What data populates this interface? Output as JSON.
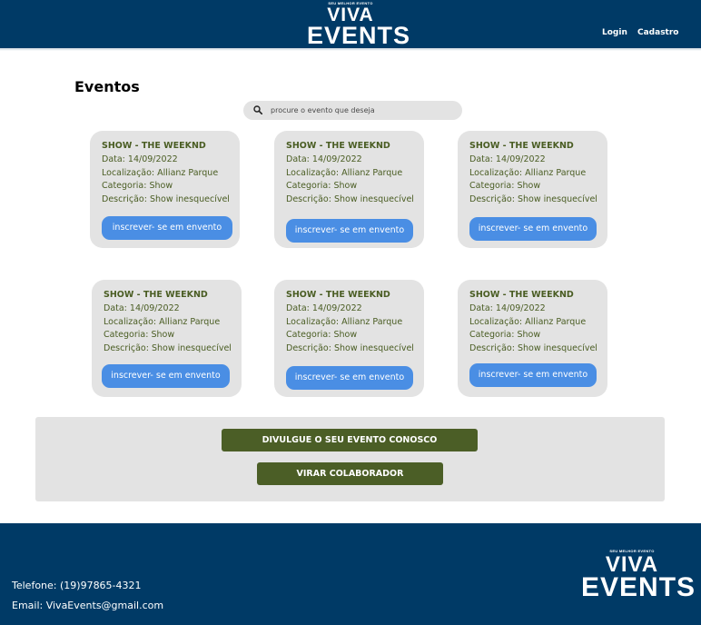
{
  "header": {
    "logo_tag": "SEU MELHOR EVENTO",
    "logo_line1": "VIVA",
    "logo_line2": "EVENTS",
    "nav": {
      "login": "Login",
      "cadastro": "Cadastro"
    }
  },
  "main": {
    "title": "Eventos",
    "search": {
      "placeholder": "procure o evento que deseja"
    },
    "cards": [
      {
        "title": "SHOW - THE WEEKND",
        "date": "Data: 14/09/2022",
        "location": "Localização: Allianz Parque",
        "category": "Categoria: Show",
        "description": "Descrição: Show inesquecível",
        "button": "inscrever- se em envento"
      },
      {
        "title": "SHOW - THE WEEKND",
        "date": "Data: 14/09/2022",
        "location": "Localização: Allianz Parque",
        "category": "Categoria: Show",
        "description": "Descrição: Show inesquecível",
        "button": "inscrever- se em envento"
      },
      {
        "title": "SHOW - THE WEEKND",
        "date": "Data: 14/09/2022",
        "location": "Localização: Allianz Parque",
        "category": "Categoria: Show",
        "description": "Descrição: Show inesquecível",
        "button": "inscrever- se em envento"
      },
      {
        "title": "SHOW - THE WEEKND",
        "date": "Data: 14/09/2022",
        "location": "Localização: Allianz Parque",
        "category": "Categoria: Show",
        "description": "Descrição: Show inesquecível",
        "button": "inscrever- se em envento"
      },
      {
        "title": "SHOW - THE WEEKND",
        "date": "Data: 14/09/2022",
        "location": "Localização: Allianz Parque",
        "category": "Categoria: Show",
        "description": "Descrição: Show inesquecível",
        "button": "inscrever- se em envento"
      },
      {
        "title": "SHOW - THE WEEKND",
        "date": "Data: 14/09/2022",
        "location": "Localização: Allianz Parque",
        "category": "Categoria: Show",
        "description": "Descrição: Show inesquecível",
        "button": "inscrever- se em envento"
      }
    ]
  },
  "banner": {
    "divulgue": "DIVULGUE O SEU EVENTO CONOSCO",
    "colaborador": "VIRAR COLABORADOR"
  },
  "footer": {
    "phone": "Telefone: (19)97865-4321",
    "email": "Email: VivaEvents@gmail.com",
    "logo_tag": "SEU MELHOR EVENTO",
    "logo_line1": "VIVA",
    "logo_line2": "EVENTS"
  },
  "colors": {
    "header_bg": "#003a66",
    "card_bg": "#e3e3e3",
    "card_text": "#4a5d23",
    "button_blue": "#4a8ee4",
    "button_green": "#4b5e26"
  },
  "icons": {
    "search": "search-icon"
  }
}
